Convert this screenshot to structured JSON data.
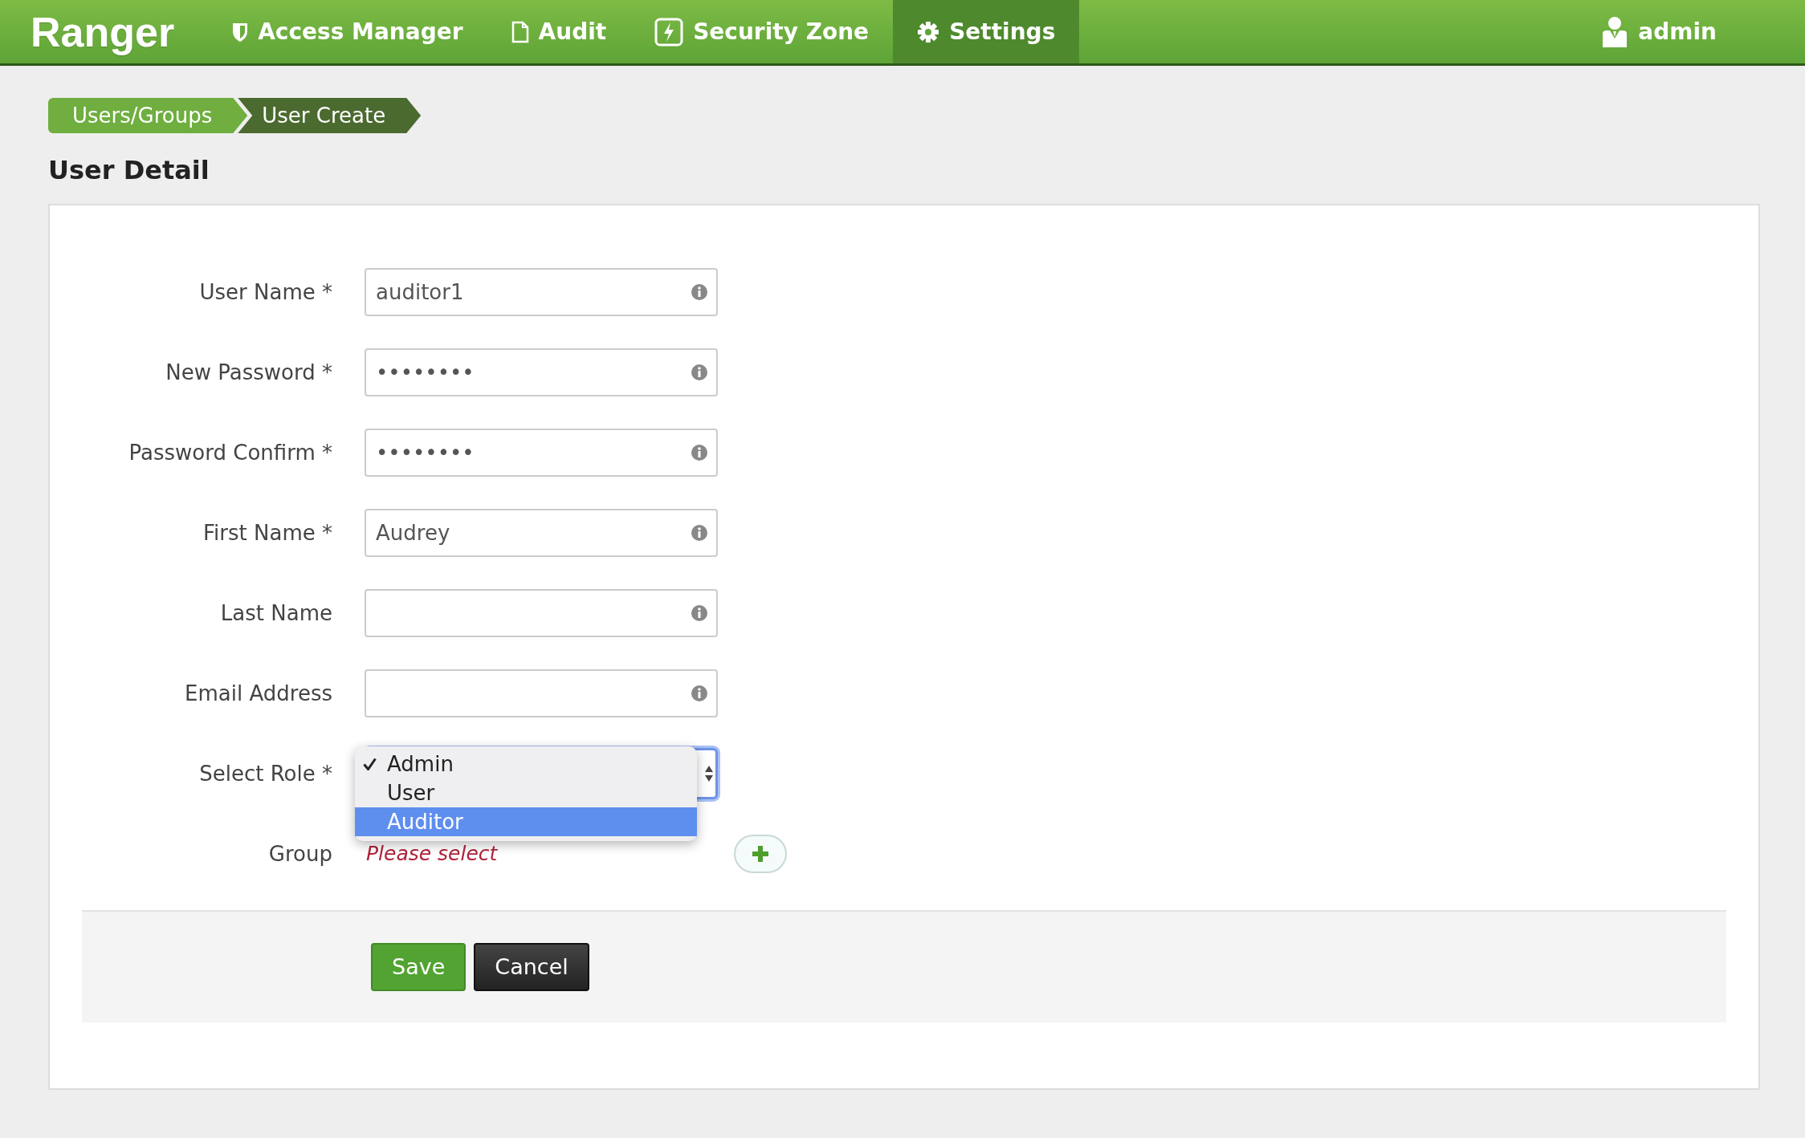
{
  "navbar": {
    "brand": "Ranger",
    "items": [
      {
        "label": "Access Manager",
        "selected": false
      },
      {
        "label": "Audit",
        "selected": false
      },
      {
        "label": "Security Zone",
        "selected": false
      },
      {
        "label": "Settings",
        "selected": true
      }
    ],
    "user": "admin"
  },
  "breadcrumb": [
    {
      "label": "Users/Groups",
      "selected": false
    },
    {
      "label": "User Create",
      "selected": true
    }
  ],
  "title": "User Detail",
  "form": {
    "fields": [
      {
        "kind": "text",
        "label": "User Name *",
        "value": "auditor1"
      },
      {
        "kind": "text",
        "label": "New Password *",
        "value": "••••••••"
      },
      {
        "kind": "text",
        "label": "Password Confirm *",
        "value": "••••••••"
      },
      {
        "kind": "text",
        "label": "First Name *",
        "value": "Audrey"
      },
      {
        "kind": "text",
        "label": "Last Name"
      },
      {
        "kind": "text",
        "label": "Email Address"
      },
      {
        "kind": "select",
        "label": "Select Role *",
        "expanded": true,
        "options": [
          {
            "label": "Admin",
            "selected": true,
            "highlighted": false
          },
          {
            "label": "User",
            "selected": false,
            "highlighted": false
          },
          {
            "label": "Auditor",
            "selected": false,
            "highlighted": true
          }
        ]
      },
      {
        "kind": "group",
        "label": "Group",
        "placeholder": "Please select"
      }
    ],
    "buttons": [
      {
        "label": "Save",
        "kind": "primary"
      },
      {
        "label": "Cancel",
        "kind": "secondary"
      }
    ]
  }
}
